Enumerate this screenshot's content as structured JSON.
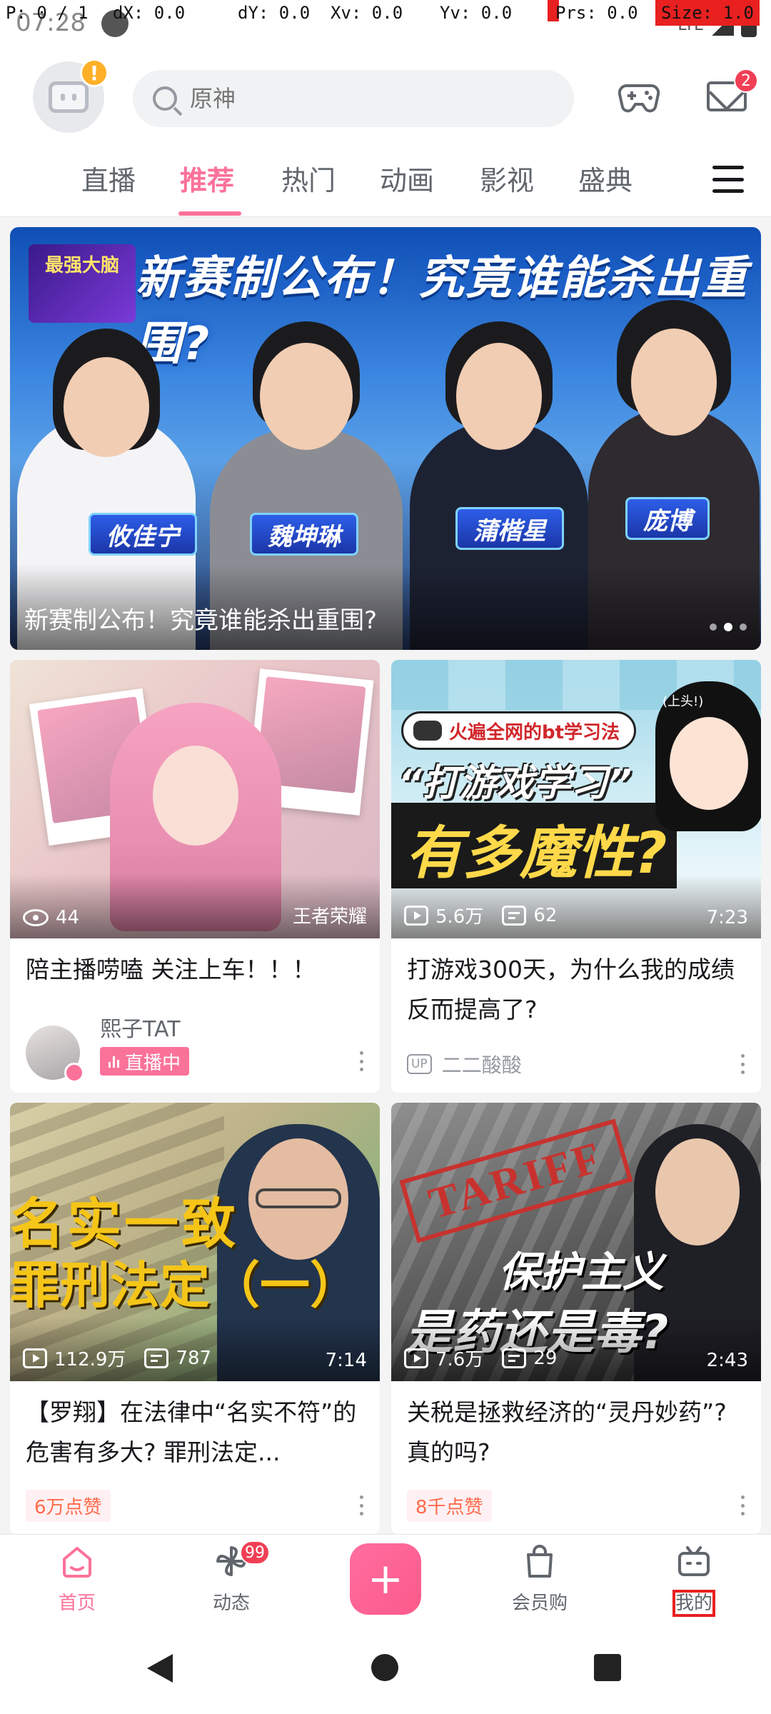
{
  "debug": {
    "pointer": "P: 0 / 1",
    "dx": "dX: 0.0",
    "dy": "dY: 0.0",
    "xv": "Xv: 0.0",
    "yv": "Yv: 0.0",
    "prs": "Prs: 0.0",
    "size": "Size: 1.0"
  },
  "status": {
    "time": "07:28",
    "network": "LTE"
  },
  "header": {
    "search_placeholder": "原神",
    "mail_badge": "2",
    "warning_mark": "!"
  },
  "tabs": [
    "直播",
    "推荐",
    "热门",
    "动画",
    "影视",
    "盛典"
  ],
  "active_tab": "推荐",
  "banner": {
    "headline": "新赛制公布！究竟谁能杀出重围?",
    "logo_text": "最强大脑",
    "name_tags": [
      "攸佳宁",
      "魏坤琳",
      "蒲楷星",
      "庞博"
    ],
    "caption": "新赛制公布！究竟谁能杀出重围?",
    "dots": 3,
    "active_dot": 2
  },
  "cards": [
    {
      "views": "44",
      "right_label": "王者荣耀",
      "title": "陪主播唠嗑 关注上车！！！",
      "author": "熙子TAT",
      "live_label": "直播中",
      "overlay": ""
    },
    {
      "views": "5.6万",
      "danmaku": "62",
      "duration": "7:23",
      "title": "打游戏300天，为什么我的成绩反而提高了?",
      "author": "二二酸酸",
      "up_label": "UP",
      "overlay_top": "火遍全网的bt学习法",
      "overlay_main": "“打游戏学习”",
      "overlay_sub": "有多魔性?",
      "overlay_bubble": "(上头!)"
    },
    {
      "views": "112.9万",
      "danmaku": "787",
      "duration": "7:14",
      "title": "【罗翔】在法律中“名实不符”的危害有多大? 罪刑法定...",
      "likes": "6万点赞",
      "overlay_line1": "名实一致",
      "overlay_line2": "罪刑法定（一）"
    },
    {
      "views": "7.6万",
      "danmaku": "29",
      "duration": "2:43",
      "title": "关税是拯救经济的“灵丹妙药”? 真的吗?",
      "likes": "8千点赞",
      "overlay_stamp": "TARIFF",
      "overlay_line1": "保护主义",
      "overlay_line2": "是药还是毒?"
    }
  ],
  "bottom_nav": {
    "home": "首页",
    "dynamic": "动态",
    "dynamic_badge": "99",
    "publish": "+",
    "mall": "会员购",
    "mine": "我的"
  },
  "colors": {
    "brand_pink": "#fb7299",
    "badge_red": "#f13f55",
    "debug_red": "#e82020"
  }
}
